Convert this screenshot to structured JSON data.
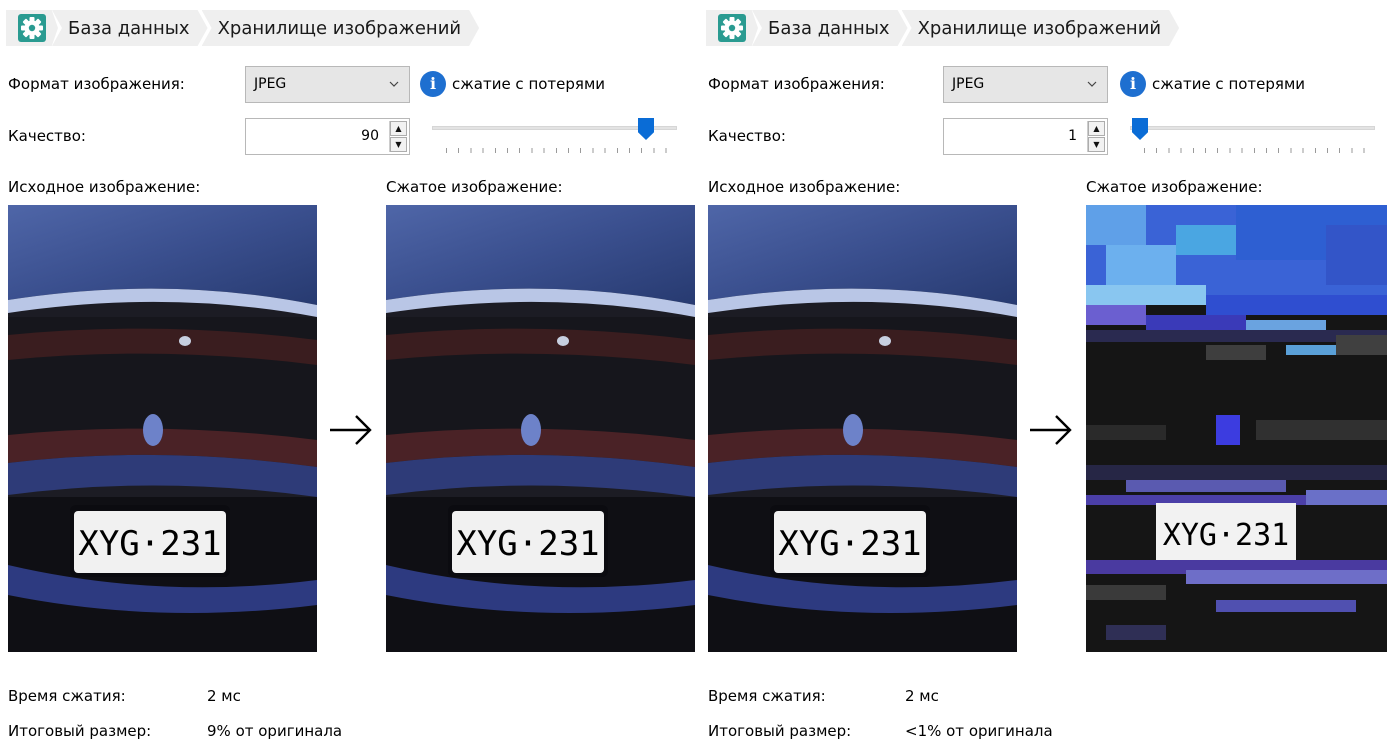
{
  "panes": [
    {
      "breadcrumb": [
        "База данных",
        "Хранилище изображений"
      ],
      "format_label": "Формат изображения:",
      "format_value": "JPEG",
      "info_text": "сжатие с потерями",
      "quality_label": "Качество:",
      "quality_value": "90",
      "slider_fraction": 0.9,
      "source_label": "Исходное изображение:",
      "compressed_label": "Сжатое изображение:",
      "source_plate": "XYG·231",
      "compressed_plate": "XYG·231",
      "stats": [
        {
          "label": "Время сжатия:",
          "value": "2 мс"
        },
        {
          "label": "Итоговый размер:",
          "value": "9% от оригинала"
        }
      ]
    },
    {
      "breadcrumb": [
        "База данных",
        "Хранилище изображений"
      ],
      "format_label": "Формат изображения:",
      "format_value": "JPEG",
      "info_text": "сжатие с потерями",
      "quality_label": "Качество:",
      "quality_value": "1",
      "slider_fraction": 0.01,
      "source_label": "Исходное изображение:",
      "compressed_label": "Сжатое изображение:",
      "source_plate": "XYG·231",
      "compressed_plate": "XYG·231",
      "stats": [
        {
          "label": "Время сжатия:",
          "value": "2 мс"
        },
        {
          "label": "Итоговый размер:",
          "value": "<1% от оригинала"
        }
      ]
    }
  ],
  "icons": {
    "settings": "gear-icon",
    "info": "info-icon",
    "chevron": "chevron-down-icon",
    "arrow": "arrow-right-icon"
  },
  "colors": {
    "accent": "#0a6cd6",
    "info": "#1e6fd0",
    "gear": "#2a9b91"
  }
}
